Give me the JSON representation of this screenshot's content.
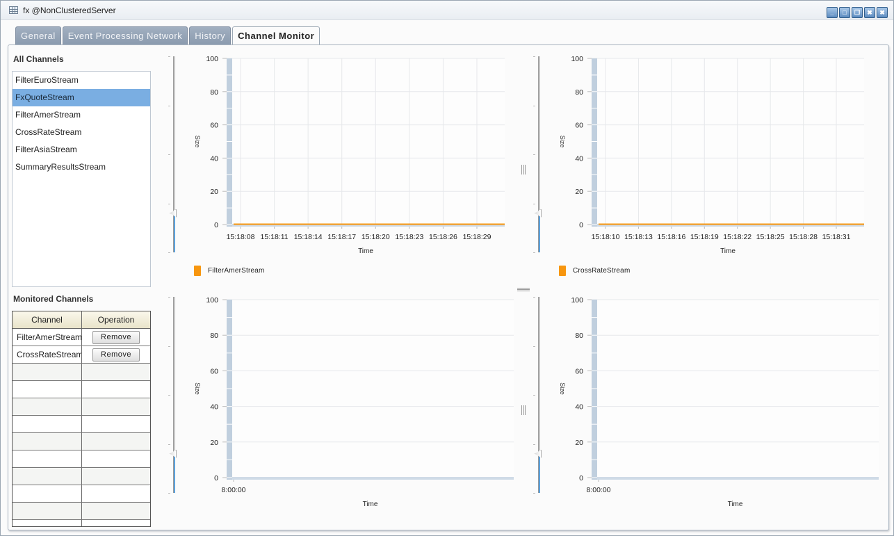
{
  "window": {
    "title": "fx @NonClusteredServer",
    "controls": [
      {
        "name": "minimize",
        "glyph": "_"
      },
      {
        "name": "maximize",
        "glyph": "□"
      },
      {
        "name": "restore",
        "glyph": "❐"
      },
      {
        "name": "close-all",
        "glyph": "✖"
      },
      {
        "name": "close",
        "glyph": "✖"
      }
    ]
  },
  "tabs": [
    {
      "label": "General",
      "active": false
    },
    {
      "label": "Event Processing Network",
      "active": false
    },
    {
      "label": "History",
      "active": false
    },
    {
      "label": "Channel Monitor",
      "active": true
    }
  ],
  "all_channels": {
    "title": "All Channels",
    "items": [
      {
        "label": "FilterEuroStream",
        "selected": false
      },
      {
        "label": "FxQuoteStream",
        "selected": true
      },
      {
        "label": "FilterAmerStream",
        "selected": false
      },
      {
        "label": "CrossRateStream",
        "selected": false
      },
      {
        "label": "FilterAsiaStream",
        "selected": false
      },
      {
        "label": "SummaryResultsStream",
        "selected": false
      }
    ]
  },
  "monitored_channels": {
    "title": "Monitored Channels",
    "columns": [
      "Channel",
      "Operation"
    ],
    "rows": [
      {
        "channel": "FilterAmerStream",
        "operation": "Remove"
      },
      {
        "channel": "CrossRateStream",
        "operation": "Remove"
      }
    ],
    "empty_rows": 10
  },
  "colors": {
    "series": "#f7960f",
    "selection": "#7aaee2",
    "slider_fill": "#5aa1dc",
    "y_band": "#c0cfde"
  },
  "chart_data": [
    {
      "type": "line",
      "title": "",
      "xlabel": "Time",
      "ylabel": "Size",
      "ylim": [
        0,
        100
      ],
      "yticks": [
        0,
        20,
        40,
        60,
        80,
        100
      ],
      "x": [
        "15:18:08",
        "15:18:11",
        "15:18:14",
        "15:18:17",
        "15:18:20",
        "15:18:23",
        "15:18:26",
        "15:18:29"
      ],
      "series": [
        {
          "name": "FilterAmerStream",
          "values": [
            0,
            0,
            0,
            0,
            0,
            0,
            0,
            0
          ]
        }
      ],
      "legend": "bottom-left",
      "grid": true,
      "slider_level": 0.2
    },
    {
      "type": "line",
      "title": "",
      "xlabel": "Time",
      "ylabel": "Size",
      "ylim": [
        0,
        100
      ],
      "yticks": [
        0,
        20,
        40,
        60,
        80,
        100
      ],
      "x": [
        "15:18:10",
        "15:18:13",
        "15:18:16",
        "15:18:19",
        "15:18:22",
        "15:18:25",
        "15:18:28",
        "15:18:31"
      ],
      "series": [
        {
          "name": "CrossRateStream",
          "values": [
            0,
            0,
            0,
            0,
            0,
            0,
            0,
            0
          ]
        }
      ],
      "legend": "bottom-left",
      "grid": true,
      "slider_level": 0.2
    },
    {
      "type": "line",
      "title": "",
      "xlabel": "Time",
      "ylabel": "Size",
      "ylim": [
        0,
        100
      ],
      "yticks": [
        0,
        20,
        40,
        60,
        80,
        100
      ],
      "x": [
        "8:00:00"
      ],
      "series": [],
      "grid": true,
      "slider_level": 0.2
    },
    {
      "type": "line",
      "title": "",
      "xlabel": "Time",
      "ylabel": "Size",
      "ylim": [
        0,
        100
      ],
      "yticks": [
        0,
        20,
        40,
        60,
        80,
        100
      ],
      "x": [
        "8:00:00"
      ],
      "series": [],
      "grid": true,
      "slider_level": 0.2
    }
  ]
}
